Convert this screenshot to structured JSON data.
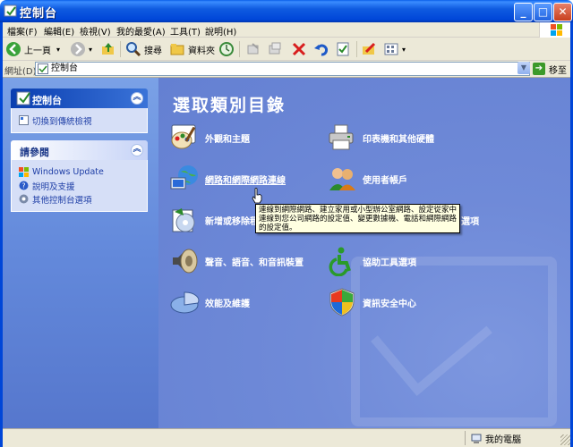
{
  "window": {
    "title": "控制台"
  },
  "menu": [
    "檔案(F)",
    "編輯(E)",
    "檢視(V)",
    "我的最愛(A)",
    "工具(T)",
    "說明(H)"
  ],
  "toolbar": {
    "back_label": "上一頁",
    "search_label": "搜尋",
    "folders_label": "資料夾"
  },
  "address": {
    "label": "網址(D)",
    "value": "控制台",
    "go_label": "移至"
  },
  "left": {
    "panel1": {
      "title": "控制台",
      "items": [
        {
          "label": "切換到傳統檢視",
          "icon": "switch-view-icon"
        }
      ]
    },
    "panel2": {
      "title": "請參閱",
      "items": [
        {
          "label": "Windows Update",
          "icon": "windows-update-icon"
        },
        {
          "label": "說明及支援",
          "icon": "help-icon"
        },
        {
          "label": "其他控制台選項",
          "icon": "options-icon"
        }
      ]
    }
  },
  "main": {
    "title": "選取類別目錄",
    "categories": [
      {
        "label": "外觀和主題",
        "icon": "appearance-icon"
      },
      {
        "label": "印表機和其他硬體",
        "icon": "printer-icon"
      },
      {
        "label": "網路和網際網路連線",
        "icon": "network-icon"
      },
      {
        "label": "使用者帳戶",
        "icon": "users-icon"
      },
      {
        "label": "新增或移除程",
        "icon": "add-remove-icon"
      },
      {
        "label": "選項",
        "icon": "date-language-icon"
      },
      {
        "label": "聲音、語音、和音訊裝置",
        "icon": "sound-icon"
      },
      {
        "label": "協助工具選項",
        "icon": "accessibility-icon"
      },
      {
        "label": "效能及維護",
        "icon": "performance-icon"
      },
      {
        "label": "資訊安全中心",
        "icon": "security-center-icon"
      }
    ],
    "tooltip": "連線到網際網路、建立家用或小型辦公室網路、設定從家中連線到您公司網路的設定值、變更數據機、電話和網際網路的設定值。"
  },
  "status": {
    "zone": "我的電腦"
  },
  "colors": {
    "title_bar": "#0046d8",
    "main_bg": "#6f8ad8",
    "left_bg": "#6e93e0",
    "chrome": "#ece9d8"
  }
}
